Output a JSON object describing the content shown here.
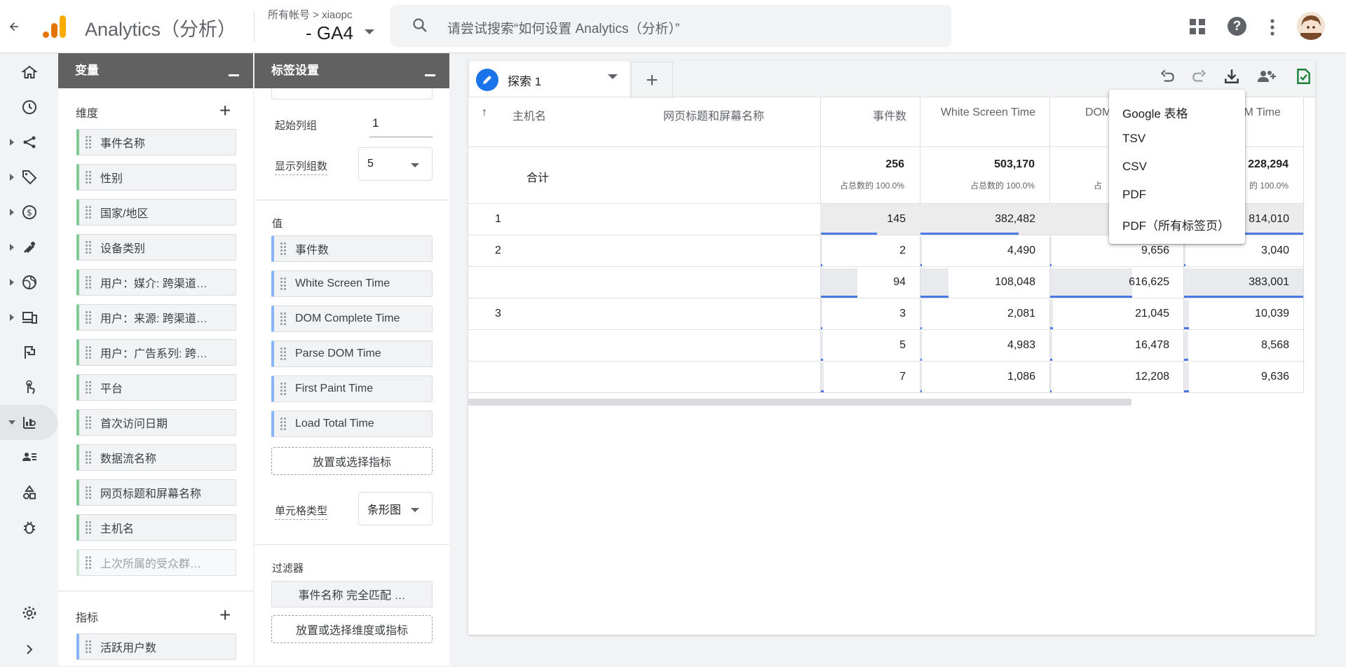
{
  "header": {
    "back_icon": "arrow-left-icon",
    "app_title": "Analytics（分析）",
    "account_path": "所有帐号 > xiaopc",
    "property": "- GA4",
    "search_placeholder": "请尝试搜索“如何设置 Analytics（分析）”",
    "brand_colors": {
      "bar1": "#e37400",
      "bar2": "#f9ab00",
      "bar3": "#e37400"
    }
  },
  "variables_panel": {
    "title": "变量",
    "dimensions_label": "维度",
    "dimensions": [
      "事件名称",
      "性别",
      "国家/地区",
      "设备类别",
      "用户：媒介: 跨渠道…",
      "用户：来源: 跨渠道…",
      "用户：广告系列: 跨…",
      "平台",
      "首次访问日期",
      "数据流名称",
      "网页标题和屏幕名称",
      "主机名",
      "上次所属的受众群…"
    ],
    "metrics_label": "指标",
    "metrics": [
      "活跃用户数"
    ]
  },
  "tab_settings_panel": {
    "title": "标签设置",
    "start_group_label": "起始列组",
    "start_group_value": "1",
    "show_groups_label": "显示列组数",
    "show_groups_value": "5",
    "values_label": "值",
    "values": [
      "事件数",
      "White Screen Time",
      "DOM Complete Time",
      "Parse DOM Time",
      "First Paint Time",
      "Load Total Time"
    ],
    "drop_metric": "放置或选择指标",
    "cell_type_label": "单元格类型",
    "cell_type_value": "条形图",
    "filters_label": "过滤器",
    "filter_chip": "事件名称 完全匹配 …",
    "drop_filter": "放置或选择维度或指标"
  },
  "explore": {
    "tab_label": "探索 1",
    "add_tab": "+",
    "columns": {
      "sort_arrow": "↑",
      "host": "主机名",
      "page_title": "网页标题和屏幕名称",
      "events": "事件数",
      "white_screen": "White Screen Time",
      "dom_partial": "DOM",
      "dom_time_partial": "OM Time"
    },
    "totals": {
      "label": "合计",
      "events": "256",
      "events_pct": "占总数的 100.0%",
      "white_screen": "503,170",
      "white_screen_pct": "占总数的 100.0%",
      "dom_pct_partial": "占",
      "last": "228,294",
      "last_pct": "的 100.0%"
    },
    "rows": [
      {
        "idx": "1",
        "events": "145",
        "white": "382,482",
        "dom": "",
        "last": "814,010"
      },
      {
        "idx": "2",
        "events": "2",
        "white": "4,490",
        "dom": "9,656",
        "last": "3,040"
      },
      {
        "idx": "",
        "events": "94",
        "white": "108,048",
        "dom": "616,625",
        "last": "383,001"
      },
      {
        "idx": "3",
        "events": "3",
        "white": "2,081",
        "dom": "21,045",
        "last": "10,039"
      },
      {
        "idx": "",
        "events": "5",
        "white": "4,983",
        "dom": "16,478",
        "last": "8,568"
      },
      {
        "idx": "",
        "events": "7",
        "white": "1,086",
        "dom": "12,208",
        "last": "9,636"
      }
    ]
  },
  "download_menu": {
    "items": [
      "Google 表格",
      "TSV",
      "CSV",
      "PDF",
      "PDF（所有标签页）"
    ]
  }
}
